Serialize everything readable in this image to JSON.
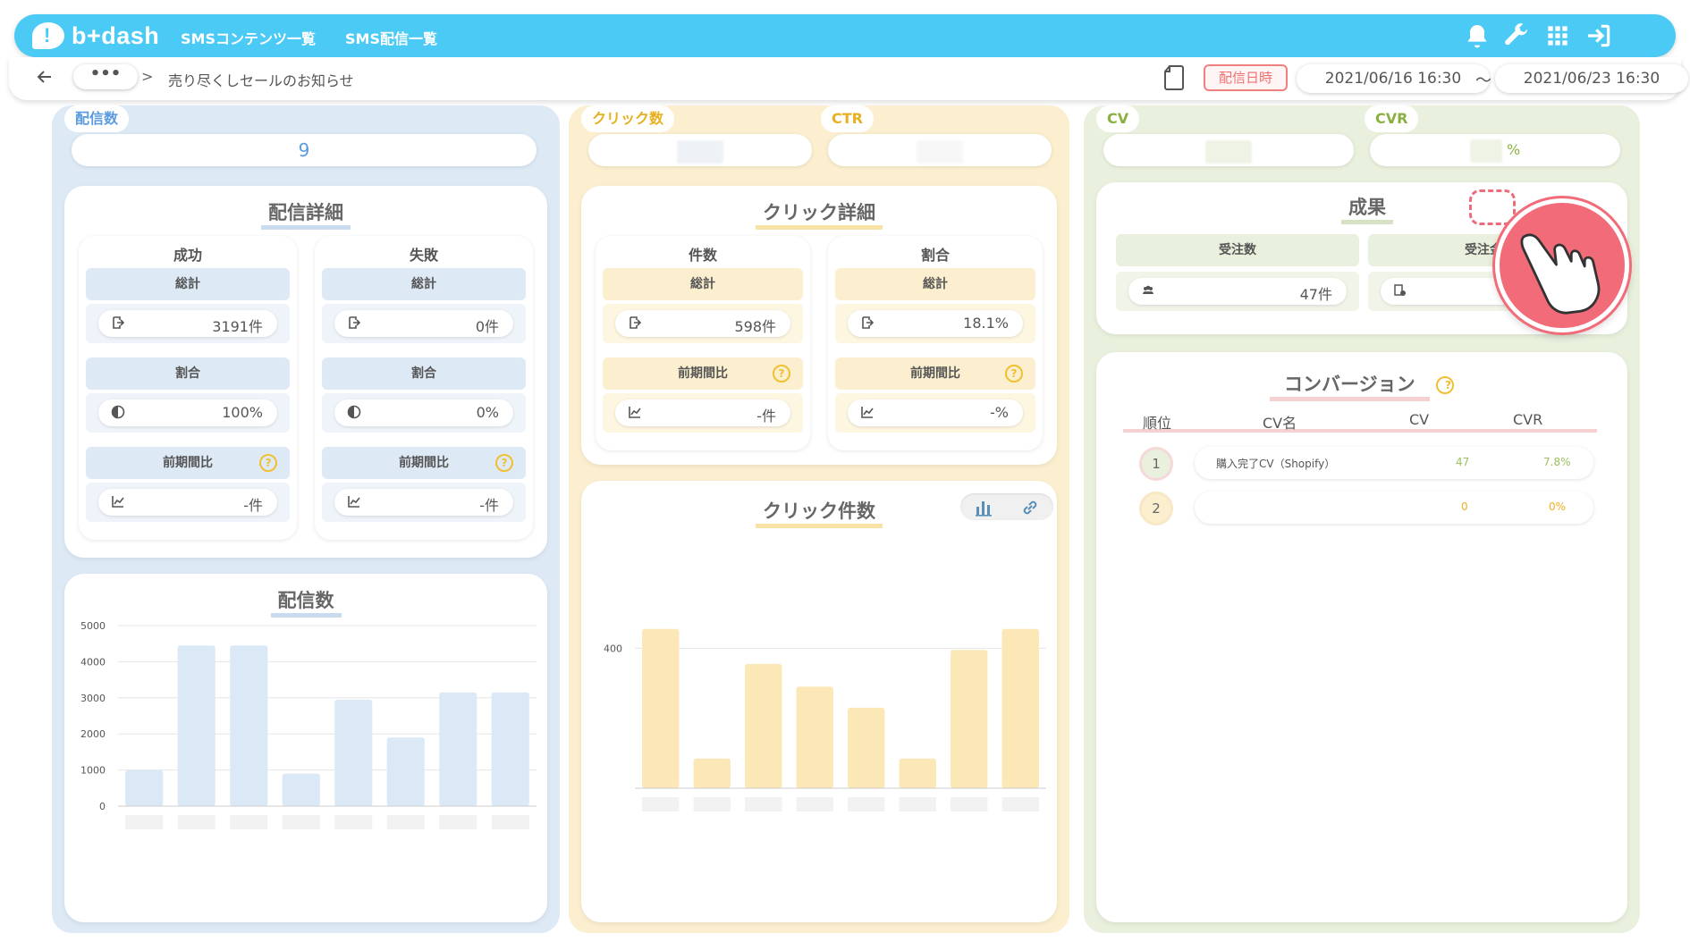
{
  "header": {
    "logo_text": "b+dash",
    "nav": [
      "SMSコンテンツ一覧",
      "SMS配信一覧"
    ],
    "icons": [
      "bell-icon",
      "wrench-icon",
      "grid-icon",
      "logout-icon"
    ]
  },
  "subbar": {
    "ellipsis": "•••",
    "separator": ">",
    "breadcrumb": "売り尽くしセールのお知らせ",
    "date_label": "配信日時",
    "date_from": "2021/06/16 16:30",
    "tilde": "〜",
    "date_to": "2021/06/23 16:30"
  },
  "blue": {
    "tag": "配信数",
    "value": "9",
    "detail_title": "配信詳細",
    "success": {
      "head": "成功",
      "total_label": "総計",
      "total_value": "3191件",
      "ratio_label": "割合",
      "ratio_value": "100%",
      "compare_label": "前期間比",
      "compare_value": "-件"
    },
    "failure": {
      "head": "失敗",
      "total_label": "総計",
      "total_value": "0件",
      "ratio_label": "割合",
      "ratio_value": "0%",
      "compare_label": "前期間比",
      "compare_value": "-件"
    },
    "chart_title": "配信数"
  },
  "yellow": {
    "tag_click": "クリック数",
    "tag_ctr": "CTR",
    "detail_title": "クリック詳細",
    "count": {
      "head": "件数",
      "total_label": "総計",
      "total_value": "598件",
      "compare_label": "前期間比",
      "compare_value": "-件"
    },
    "ratio": {
      "head": "割合",
      "total_label": "総計",
      "total_value": "18.1%",
      "compare_label": "前期間比",
      "compare_value": "-%"
    },
    "chart_title": "クリック件数"
  },
  "green": {
    "tag_cv": "CV",
    "tag_cvr": "CVR",
    "cvr_suffix": "%",
    "result_title": "成果",
    "orders_label": "受注数",
    "orders_value": "47件",
    "amount_label": "受注金",
    "conv_title": "コンバージョン",
    "conv_headers": [
      "順位",
      "CV名",
      "CV",
      "CVR"
    ],
    "conv_rows": [
      {
        "rank": "1",
        "name": "購入完了CV（Shopify）",
        "cv": "47",
        "cvr": "7.8%"
      },
      {
        "rank": "2",
        "name": "",
        "cv": "0",
        "cvr": "0%"
      }
    ]
  },
  "colors": {
    "header": "#4ccaf6",
    "blue_panel": "#dde9f5",
    "yellow_panel": "#fbefcf",
    "green_panel": "#e9f0dd",
    "accent_red": "#f26b78"
  },
  "chart_data": [
    {
      "type": "bar",
      "title": "配信数",
      "categories": [
        "",
        "",
        "",
        "",
        "",
        "",
        "",
        ""
      ],
      "values": [
        1000,
        4450,
        4450,
        900,
        2950,
        1900,
        3150,
        3150
      ],
      "yticks": [
        0,
        1000,
        2000,
        3000,
        4000,
        5000
      ],
      "ylim": [
        0,
        5000
      ],
      "color": "#dbe9f7"
    },
    {
      "type": "bar",
      "title": "クリック件数",
      "categories": [
        "",
        "",
        "",
        "",
        "",
        "",
        "",
        ""
      ],
      "values": [
        455,
        85,
        355,
        290,
        230,
        85,
        395,
        455
      ],
      "yticks": [
        400
      ],
      "ylim": [
        0,
        480
      ],
      "color": "#fbe8b6"
    }
  ]
}
